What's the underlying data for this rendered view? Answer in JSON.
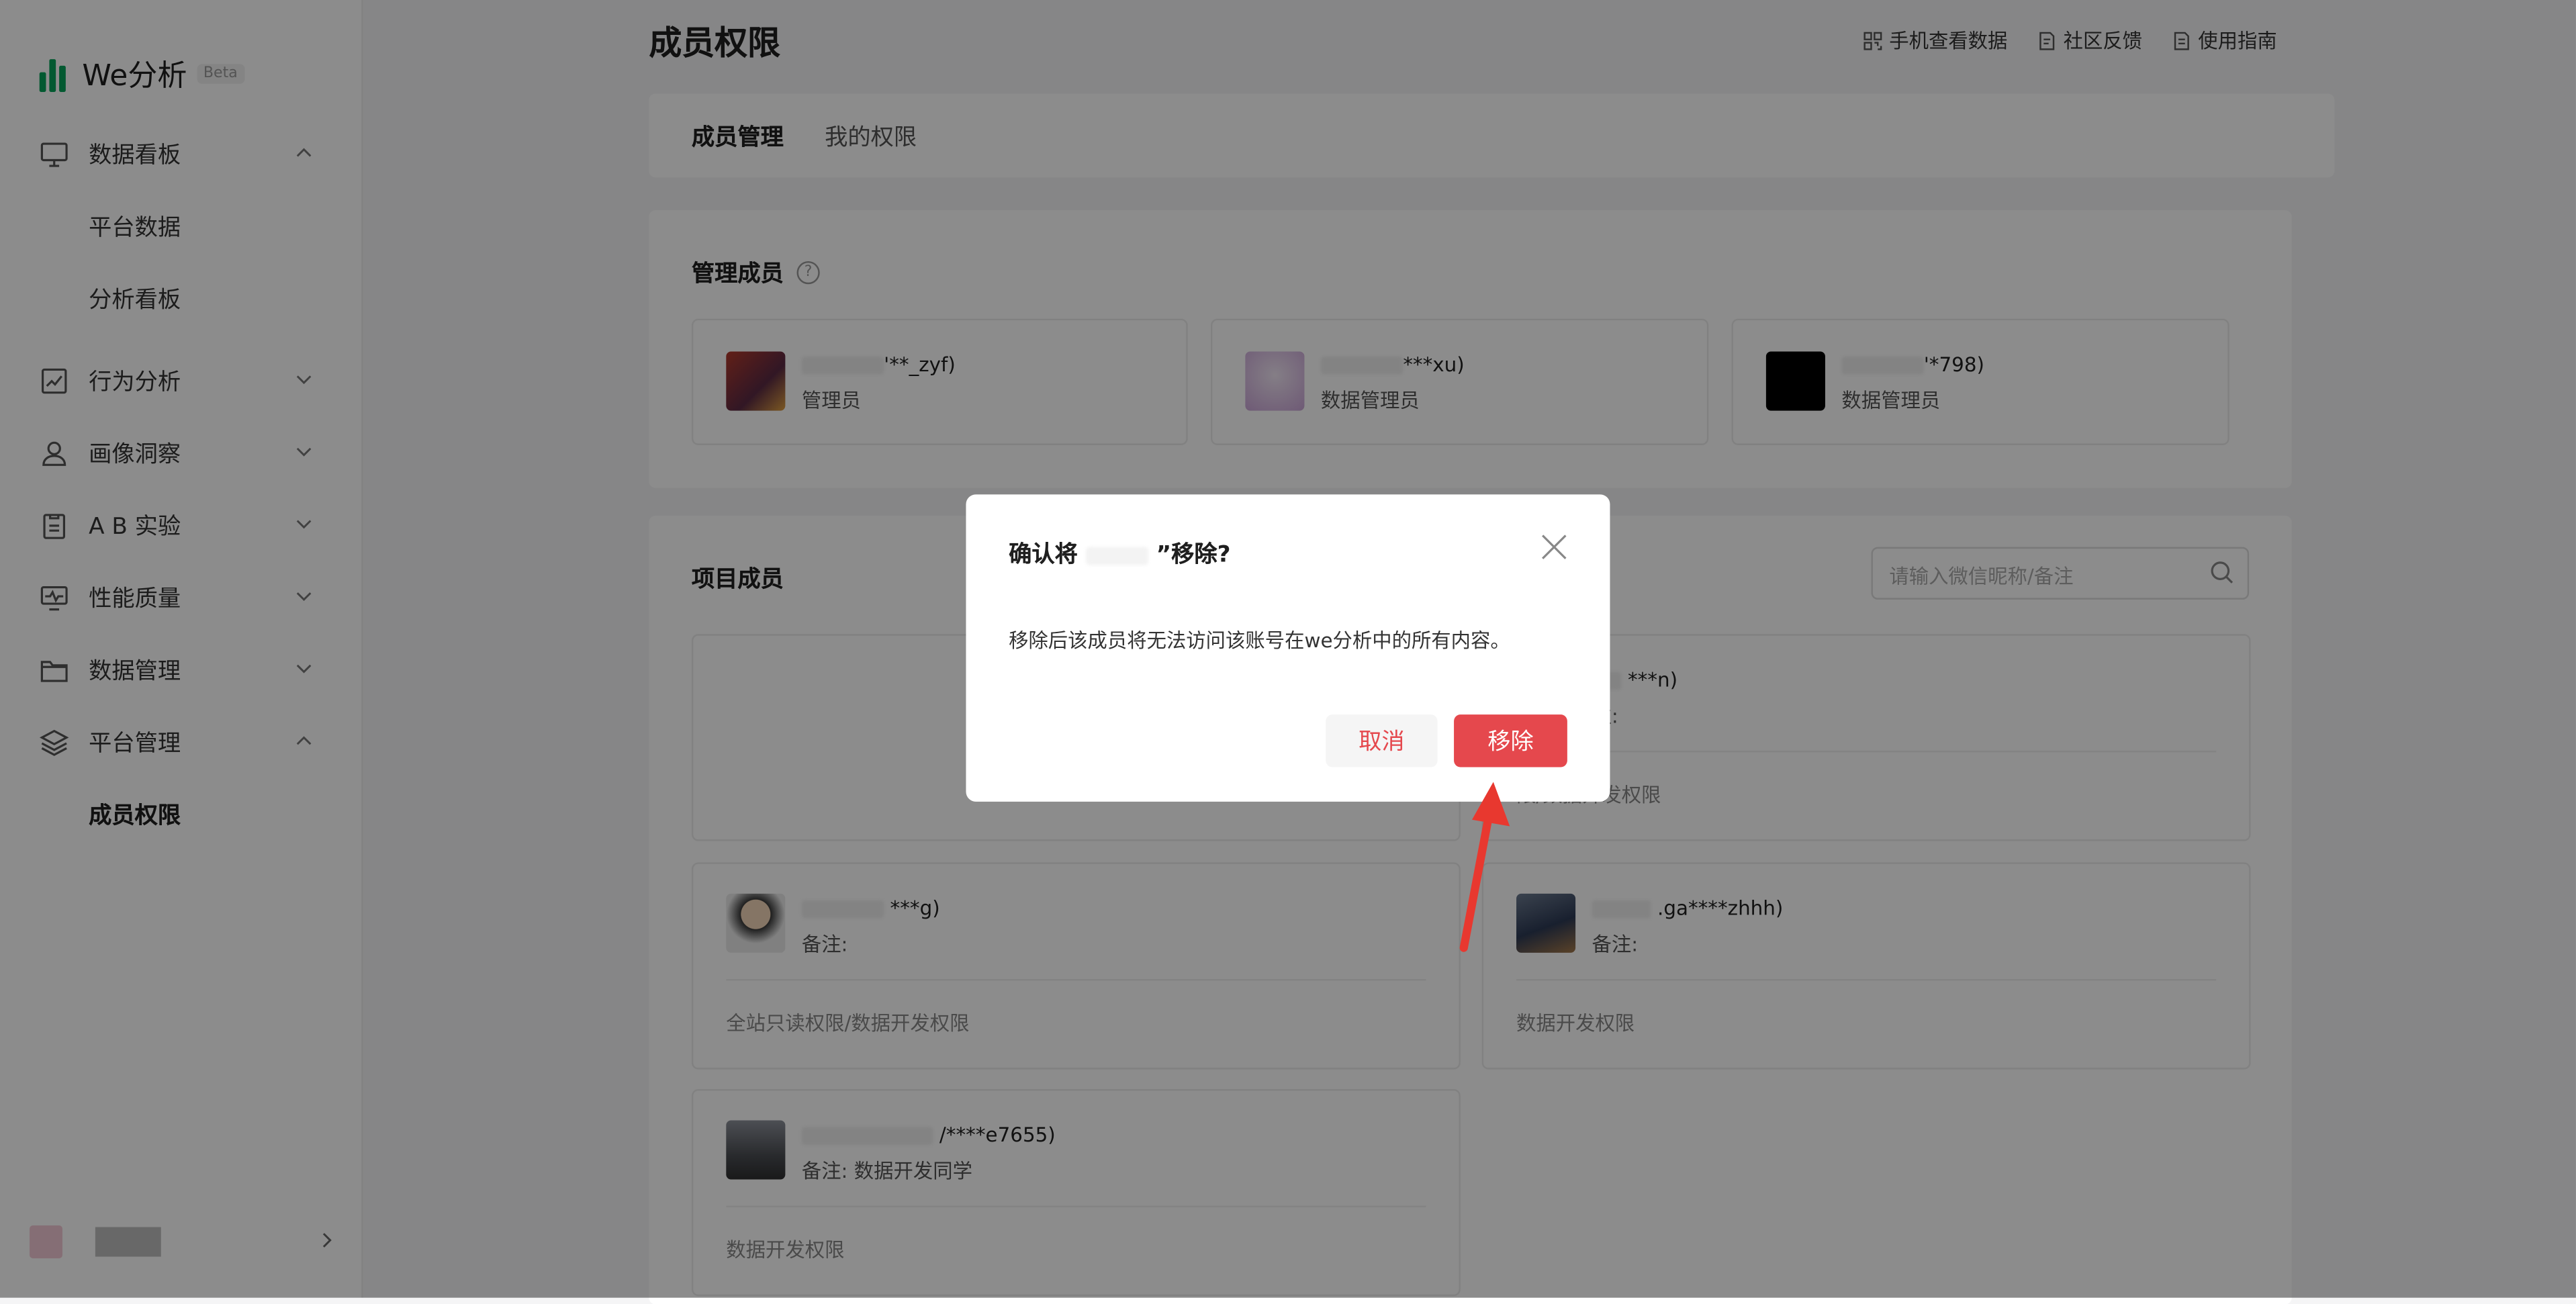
{
  "app": {
    "name": "We分析",
    "badge": "Beta"
  },
  "sidebar": {
    "items": [
      {
        "label": "数据看板",
        "icon": "monitor-icon",
        "expanded": true
      },
      {
        "label": "平台数据",
        "sub": true
      },
      {
        "label": "分析看板",
        "sub": true
      },
      {
        "label": "行为分析",
        "icon": "chart-line-icon",
        "expanded": false
      },
      {
        "label": "画像洞察",
        "icon": "user-icon",
        "expanded": false
      },
      {
        "label": "A B 实验",
        "icon": "clipboard-icon",
        "expanded": false
      },
      {
        "label": "性能质量",
        "icon": "pulse-monitor-icon",
        "expanded": false
      },
      {
        "label": "数据管理",
        "icon": "folder-icon",
        "expanded": false
      },
      {
        "label": "平台管理",
        "icon": "layers-icon",
        "expanded": true
      },
      {
        "label": "成员权限",
        "sub": true,
        "active": true
      }
    ]
  },
  "header": {
    "title": "成员权限",
    "links": [
      "手机查看数据",
      "社区反馈",
      "使用指南"
    ]
  },
  "tabs": [
    "成员管理",
    "我的权限"
  ],
  "admins": {
    "title": "管理成员",
    "members": [
      {
        "nick": "'**_zyf)",
        "role": "管理员"
      },
      {
        "nick": "***xu)",
        "role": "数据管理员"
      },
      {
        "nick": "'*798)",
        "role": "数据管理员"
      }
    ]
  },
  "projects": {
    "title": "项目成员",
    "search_placeholder": "请输入微信昵称/备注",
    "members": [
      {
        "nick": "***n)",
        "note": "注:",
        "perm": "限/数据开发权限"
      },
      {
        "nick": "***g)",
        "note": "备注:",
        "perm": "全站只读权限/数据开发权限"
      },
      {
        "nick": ".ga****zhhh)",
        "note": "备注:",
        "perm": "数据开发权限"
      },
      {
        "nick": "/****e7655)",
        "note": "备注: 数据开发同学",
        "perm": "数据开发权限"
      }
    ]
  },
  "modal": {
    "title_prefix": "确认将",
    "title_suffix": "”移除?",
    "body": "移除后该成员将无法访问该账号在we分析中的所有内容。",
    "cancel": "取消",
    "confirm": "移除"
  },
  "colors": {
    "brand": "#07a35a",
    "danger": "#e5484d",
    "annotation_arrow": "#e8382f"
  }
}
